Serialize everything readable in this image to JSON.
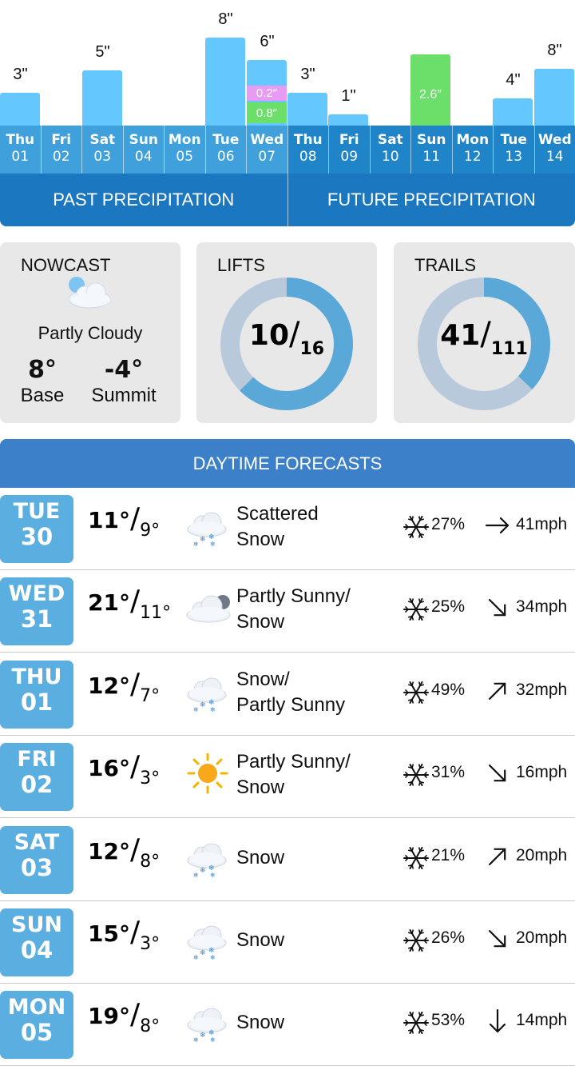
{
  "precipitation": {
    "days": [
      {
        "name": "Thu",
        "date": "01",
        "period": "past",
        "label": "3\"",
        "value": 3
      },
      {
        "name": "Fri",
        "date": "02",
        "period": "past",
        "label": "",
        "value": 0
      },
      {
        "name": "Sat",
        "date": "03",
        "period": "past",
        "label": "5\"",
        "value": 5
      },
      {
        "name": "Sun",
        "date": "04",
        "period": "past",
        "label": "",
        "value": 0
      },
      {
        "name": "Mon",
        "date": "05",
        "period": "past",
        "label": "",
        "value": 0
      },
      {
        "name": "Tue",
        "date": "06",
        "period": "past",
        "label": "8\"",
        "value": 8
      },
      {
        "name": "Wed",
        "date": "07",
        "period": "past",
        "label": "6\"",
        "value": 6,
        "segments": [
          {
            "label": "0.2″",
            "color": "#e79bf2"
          },
          {
            "label": "0.8″",
            "color": "#6bdf6a"
          }
        ]
      },
      {
        "name": "Thu",
        "date": "08",
        "period": "future",
        "label": "3\"",
        "value": 3
      },
      {
        "name": "Fri",
        "date": "09",
        "period": "future",
        "label": "1\"",
        "value": 1
      },
      {
        "name": "Sat",
        "date": "10",
        "period": "future",
        "label": "",
        "value": 0
      },
      {
        "name": "Sun",
        "date": "11",
        "period": "future",
        "label": "2.6″",
        "value": 6.5,
        "inner_label": true,
        "color": "#6bdf6a"
      },
      {
        "name": "Mon",
        "date": "12",
        "period": "future",
        "label": "",
        "value": 0
      },
      {
        "name": "Tue",
        "date": "13",
        "period": "future",
        "label": "4\"",
        "value": 2.5
      },
      {
        "name": "Wed",
        "date": "14",
        "period": "future",
        "label": "8\"",
        "value": 5.2
      }
    ],
    "past_tab": "PAST PRECIPITATION",
    "future_tab": "FUTURE PRECIPITATION"
  },
  "nowcast": {
    "title": "NOWCAST",
    "icon": "partly-cloudy-icon",
    "condition": "Partly Cloudy",
    "base_temp": "8°",
    "base_label": "Base",
    "summit_temp": "-4°",
    "summit_label": "Summit"
  },
  "lifts": {
    "title": "LIFTS",
    "open": "10",
    "total": "16",
    "fraction": 0.625
  },
  "trails": {
    "title": "TRAILS",
    "open": "41",
    "total": "111",
    "fraction": 0.37
  },
  "colors": {
    "donut_fill": "#5aa8d8",
    "donut_track": "#b9c9dc",
    "bar": "#64c8ff"
  },
  "daytime": {
    "title": "DAYTIME FORECASTS",
    "rows": [
      {
        "dow": "TUE",
        "day": "30",
        "hi": "11°",
        "lo": "9°",
        "icon": "snow-cloud-icon",
        "cond1": "Scattered",
        "cond2": "Snow",
        "pct": "27%",
        "dir": "east",
        "wind": "41mph"
      },
      {
        "dow": "WED",
        "day": "31",
        "hi": "21°",
        "lo": "11°",
        "icon": "partly-sunny-cloud-icon",
        "cond1": "Partly Sunny/",
        "cond2": "Snow",
        "pct": "25%",
        "dir": "southeast",
        "wind": "34mph"
      },
      {
        "dow": "THU",
        "day": "01",
        "hi": "12°",
        "lo": "7°",
        "icon": "snow-cloud-icon",
        "cond1": "Snow/",
        "cond2": "Partly Sunny",
        "pct": "49%",
        "dir": "northeast",
        "wind": "32mph"
      },
      {
        "dow": "FRI",
        "day": "02",
        "hi": "16°",
        "lo": "3°",
        "icon": "sun-icon",
        "cond1": "Partly Sunny/",
        "cond2": "Snow",
        "pct": "31%",
        "dir": "southeast",
        "wind": "16mph"
      },
      {
        "dow": "SAT",
        "day": "03",
        "hi": "12°",
        "lo": "8°",
        "icon": "snow-cloud-icon",
        "cond1": "Snow",
        "cond2": "",
        "pct": "21%",
        "dir": "northeast",
        "wind": "20mph"
      },
      {
        "dow": "SUN",
        "day": "04",
        "hi": "15°",
        "lo": "3°",
        "icon": "snow-cloud-icon",
        "cond1": "Snow",
        "cond2": "",
        "pct": "26%",
        "dir": "southeast",
        "wind": "20mph"
      },
      {
        "dow": "MON",
        "day": "05",
        "hi": "19°",
        "lo": "8°",
        "icon": "snow-cloud-icon",
        "cond1": "Snow",
        "cond2": "",
        "pct": "53%",
        "dir": "south",
        "wind": "14mph"
      }
    ]
  }
}
